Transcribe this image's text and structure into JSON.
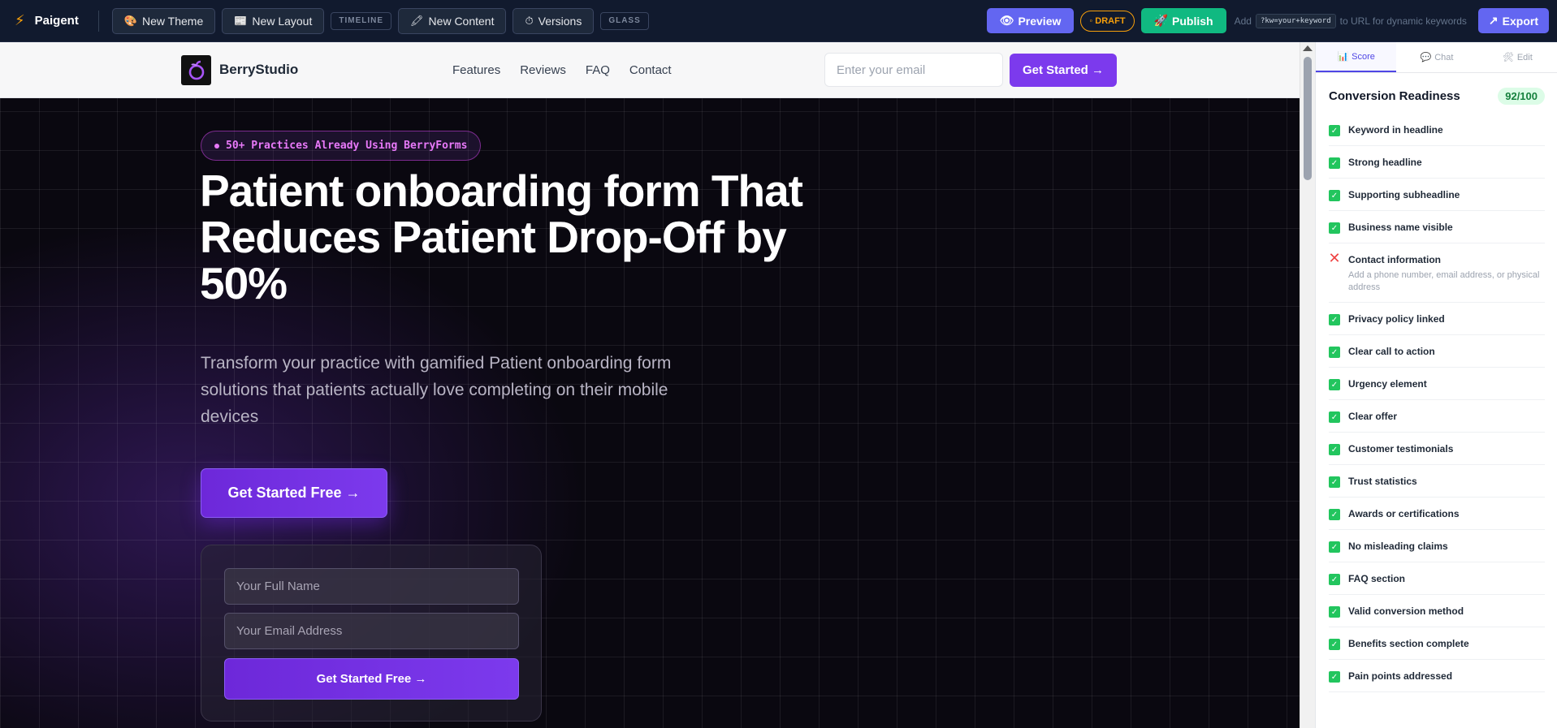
{
  "app": {
    "name": "Paigent",
    "toolbar": {
      "new_theme": "New Theme",
      "new_layout": "New Layout",
      "timeline_tag": "TIMELINE",
      "new_content": "New Content",
      "versions": "Versions",
      "glass_tag": "GLASS",
      "preview": "Preview",
      "draft": "DRAFT",
      "publish": "Publish",
      "hint_prefix": "Add",
      "hint_code": "?kw=your+keyword",
      "hint_suffix": "to URL for dynamic keywords",
      "export": "Export"
    }
  },
  "site": {
    "brand": "BerryStudio",
    "nav_links": [
      "Features",
      "Reviews",
      "FAQ",
      "Contact"
    ],
    "nav_email_placeholder": "Enter your email",
    "nav_cta": "Get Started →",
    "pill": "50+ Practices Already Using BerryForms",
    "headline": "Patient onboarding form That Reduces Patient Drop-Off by 50%",
    "subheadline": "Transform your practice with gamified Patient onboarding form solutions that patients actually love completing on their mobile devices",
    "hero_cta": "Get Started Free →",
    "form": {
      "name_placeholder": "Your Full Name",
      "email_placeholder": "Your Email Address",
      "submit": "Get Started Free →"
    }
  },
  "panel": {
    "tabs": [
      {
        "label": "Score",
        "icon": "📊"
      },
      {
        "label": "Chat",
        "icon": "💬"
      },
      {
        "label": "Edit",
        "icon": "🛠"
      }
    ],
    "score_title": "Conversion Readiness",
    "score_value": "92/100",
    "checks": [
      {
        "label": "Keyword in headline",
        "passed": true
      },
      {
        "label": "Strong headline",
        "passed": true
      },
      {
        "label": "Supporting subheadline",
        "passed": true
      },
      {
        "label": "Business name visible",
        "passed": true
      },
      {
        "label": "Contact information",
        "passed": false,
        "note": "Add a phone number, email address, or physical address"
      },
      {
        "label": "Privacy policy linked",
        "passed": true
      },
      {
        "label": "Clear call to action",
        "passed": true
      },
      {
        "label": "Urgency element",
        "passed": true
      },
      {
        "label": "Clear offer",
        "passed": true
      },
      {
        "label": "Customer testimonials",
        "passed": true
      },
      {
        "label": "Trust statistics",
        "passed": true
      },
      {
        "label": "Awards or certifications",
        "passed": true
      },
      {
        "label": "No misleading claims",
        "passed": true
      },
      {
        "label": "FAQ section",
        "passed": true
      },
      {
        "label": "Valid conversion method",
        "passed": true
      },
      {
        "label": "Benefits section complete",
        "passed": true
      },
      {
        "label": "Pain points addressed",
        "passed": true
      }
    ]
  },
  "colors": {
    "accent": "#6366f1",
    "brand_purple": "#7c3aed",
    "publish_green": "#10b981",
    "draft_amber": "#f59e0b",
    "pass_green": "#22c55e",
    "fail_red": "#ef4444"
  }
}
